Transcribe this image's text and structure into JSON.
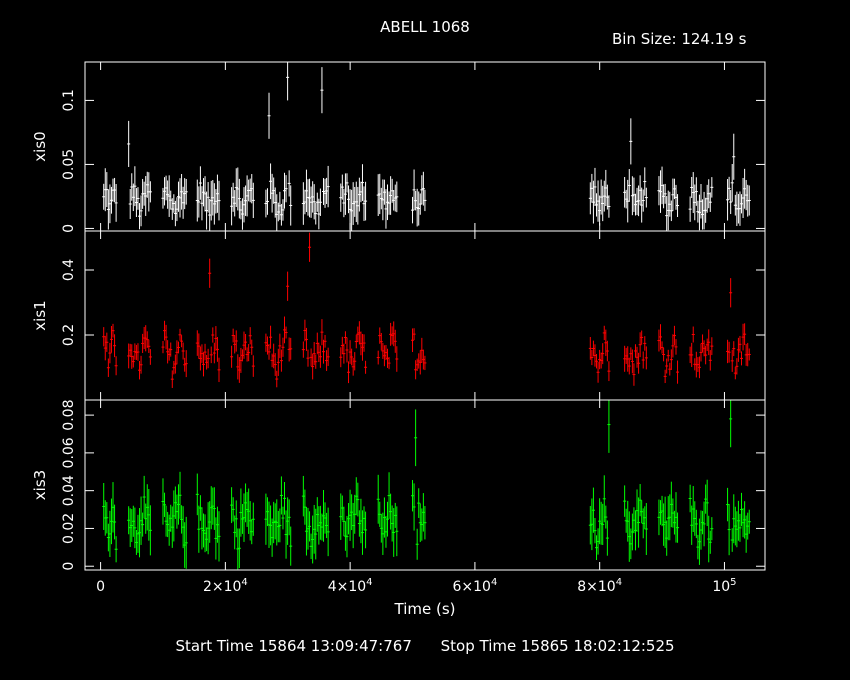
{
  "chart_data": {
    "type": "scatter",
    "title": "ABELL 1068",
    "bin_size_label": "Bin Size: 124.19 s",
    "xlabel": "Time (s)",
    "xlim": [
      -2500,
      106500
    ],
    "x_ticks": [
      {
        "value": 0,
        "mant": "0",
        "exp": ""
      },
      {
        "value": 20000,
        "mant": "2×10",
        "exp": "4"
      },
      {
        "value": 40000,
        "mant": "4×10",
        "exp": "4"
      },
      {
        "value": 60000,
        "mant": "6×10",
        "exp": "4"
      },
      {
        "value": 80000,
        "mant": "8×10",
        "exp": "4"
      },
      {
        "value": 100000,
        "mant": "10",
        "exp": "5"
      }
    ],
    "start_time": "Start Time 15864 13:09:47:767",
    "stop_time": "Stop Time 15865 18:02:12:525",
    "segments": [
      [
        500,
        2500
      ],
      [
        4500,
        8000
      ],
      [
        10000,
        13800
      ],
      [
        15500,
        19000
      ],
      [
        21000,
        24500
      ],
      [
        26500,
        30500
      ],
      [
        32500,
        36500
      ],
      [
        38500,
        42500
      ],
      [
        44500,
        47500
      ],
      [
        50000,
        52000
      ],
      [
        78500,
        81500
      ],
      [
        84000,
        87500
      ],
      [
        89500,
        92500
      ],
      [
        94500,
        98000
      ],
      [
        100500,
        104000
      ]
    ],
    "panels": [
      {
        "ylabel": "xis0",
        "color": "#ffffff",
        "ylim": [
          -0.002,
          0.13
        ],
        "y_ticks": [
          {
            "value": 0,
            "label": "0"
          },
          {
            "value": 0.05,
            "label": "0.05"
          },
          {
            "value": 0.1,
            "label": "0.1"
          }
        ],
        "typical": 0.022,
        "spread": 0.011,
        "err": 0.012,
        "peaks": [
          {
            "x": 30000,
            "y": 0.13
          },
          {
            "x": 35500,
            "y": 0.12
          },
          {
            "x": 27000,
            "y": 0.1
          },
          {
            "x": 4500,
            "y": 0.078
          },
          {
            "x": 101500,
            "y": 0.068
          },
          {
            "x": 85000,
            "y": 0.08
          }
        ]
      },
      {
        "ylabel": "xis1",
        "color": "#ff0000",
        "ylim": [
          0.0,
          0.52
        ],
        "y_ticks": [
          {
            "value": 0.2,
            "label": "0.2"
          },
          {
            "value": 0.4,
            "label": "0.4"
          }
        ],
        "typical": 0.14,
        "spread": 0.055,
        "err": 0.03,
        "peaks": [
          {
            "x": 33500,
            "y": 0.5
          },
          {
            "x": 17500,
            "y": 0.42
          },
          {
            "x": 30000,
            "y": 0.38
          },
          {
            "x": 101000,
            "y": 0.36
          }
        ]
      },
      {
        "ylabel": "xis3",
        "color": "#00ff00",
        "ylim": [
          -0.002,
          0.088
        ],
        "y_ticks": [
          {
            "value": 0,
            "label": "0"
          },
          {
            "value": 0.02,
            "label": "0.02"
          },
          {
            "value": 0.04,
            "label": "0.04"
          },
          {
            "value": 0.06,
            "label": "0.06"
          },
          {
            "value": 0.08,
            "label": "0.08"
          }
        ],
        "typical": 0.024,
        "spread": 0.011,
        "err": 0.01,
        "peaks": [
          {
            "x": 101000,
            "y": 0.088
          },
          {
            "x": 81500,
            "y": 0.085
          },
          {
            "x": 50500,
            "y": 0.078
          },
          {
            "x": 83500,
            "y": 0.077
          }
        ]
      }
    ]
  }
}
